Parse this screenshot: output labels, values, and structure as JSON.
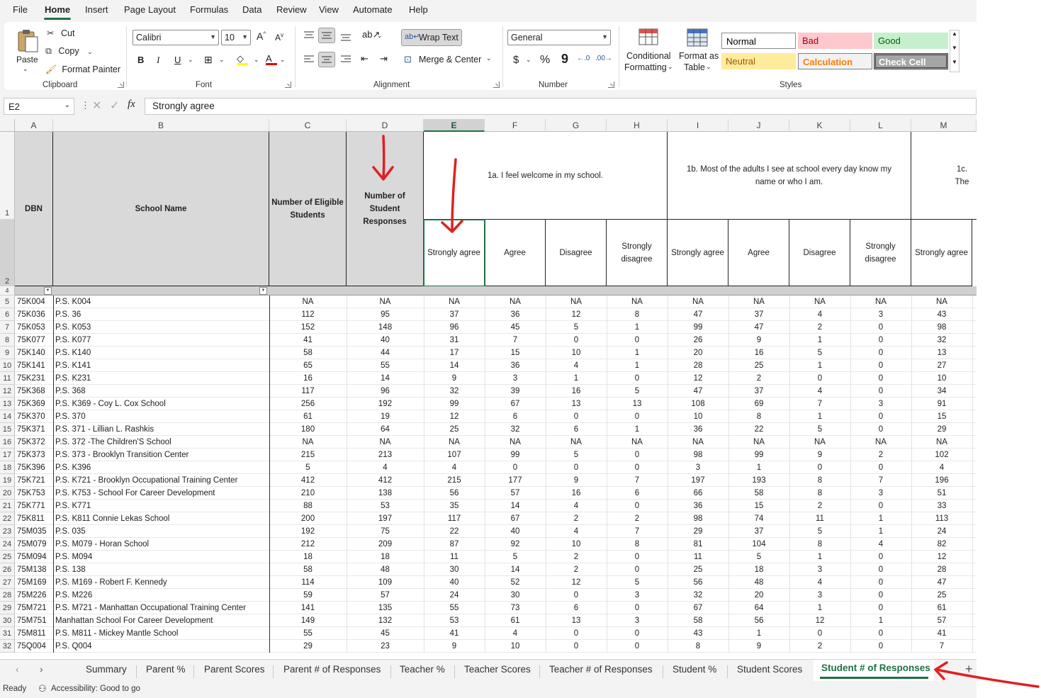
{
  "menu": [
    "File",
    "Home",
    "Insert",
    "Page Layout",
    "Formulas",
    "Data",
    "Review",
    "View",
    "Automate",
    "Help"
  ],
  "ribbon": {
    "paste": "Paste",
    "cut": "Cut",
    "copy": "Copy",
    "format_painter": "Format Painter",
    "clipboard_label": "Clipboard",
    "font_name": "Calibri",
    "font_size": "10",
    "font_label": "Font",
    "bold": "B",
    "italic": "I",
    "underline": "U",
    "wrap_text": "Wrap Text",
    "merge_center": "Merge & Center",
    "alignment_label": "Alignment",
    "number_format": "General",
    "currency": "$",
    "percent": "%",
    "comma": "9",
    "number_label": "Number",
    "cond_format_1": "Conditional",
    "cond_format_2": "Formatting",
    "format_table_1": "Format as",
    "format_table_2": "Table",
    "styles": {
      "normal": "Normal",
      "bad": "Bad",
      "good": "Good",
      "neutral": "Neutral",
      "calculation": "Calculation",
      "check_cell": "Check Cell"
    },
    "styles_label": "Styles"
  },
  "formula_bar": {
    "name_box": "E2",
    "fx": "fx",
    "content": "Strongly agree"
  },
  "columns": [
    "A",
    "B",
    "C",
    "D",
    "E",
    "F",
    "G",
    "H",
    "I",
    "J",
    "K",
    "L",
    "M"
  ],
  "headers": {
    "dbn": "DBN",
    "school_name": "School Name",
    "eligible": "Number of Eligible Students",
    "responses": "Number of Student Responses",
    "q1a": "1a. I feel welcome in my school.",
    "q1b": "1b. Most of the adults I see at school every day know my name or who I am.",
    "q1c": "1c. The",
    "strongly_agree": "Strongly agree",
    "agree": "Agree",
    "disagree": "Disagree",
    "strongly_disagree": "Strongly disagree"
  },
  "row_numbers": [
    "1",
    "2",
    "4",
    "5",
    "6",
    "7",
    "8",
    "9",
    "10",
    "11",
    "12",
    "13",
    "14",
    "15",
    "16",
    "17",
    "18",
    "19",
    "20",
    "21",
    "22",
    "23",
    "24",
    "25",
    "26",
    "27",
    "28",
    "29",
    "30",
    "31",
    "32"
  ],
  "rows": [
    [
      "75K004",
      "P.S. K004",
      "NA",
      "NA",
      "NA",
      "NA",
      "NA",
      "NA",
      "NA",
      "NA",
      "NA",
      "NA",
      "NA"
    ],
    [
      "75K036",
      "P.S. 36",
      "112",
      "95",
      "37",
      "36",
      "12",
      "8",
      "47",
      "37",
      "4",
      "3",
      "43"
    ],
    [
      "75K053",
      "P.S. K053",
      "152",
      "148",
      "96",
      "45",
      "5",
      "1",
      "99",
      "47",
      "2",
      "0",
      "98"
    ],
    [
      "75K077",
      "P.S. K077",
      "41",
      "40",
      "31",
      "7",
      "0",
      "0",
      "26",
      "9",
      "1",
      "0",
      "32"
    ],
    [
      "75K140",
      "P.S. K140",
      "58",
      "44",
      "17",
      "15",
      "10",
      "1",
      "20",
      "16",
      "5",
      "0",
      "13"
    ],
    [
      "75K141",
      "P.S. K141",
      "65",
      "55",
      "14",
      "36",
      "4",
      "1",
      "28",
      "25",
      "1",
      "0",
      "27"
    ],
    [
      "75K231",
      "P.S. K231",
      "16",
      "14",
      "9",
      "3",
      "1",
      "0",
      "12",
      "2",
      "0",
      "0",
      "10"
    ],
    [
      "75K368",
      "P.S. 368",
      "117",
      "96",
      "32",
      "39",
      "16",
      "5",
      "47",
      "37",
      "4",
      "0",
      "34"
    ],
    [
      "75K369",
      "P.S. K369 - Coy L. Cox School",
      "256",
      "192",
      "99",
      "67",
      "13",
      "13",
      "108",
      "69",
      "7",
      "3",
      "91"
    ],
    [
      "75K370",
      "P.S. 370",
      "61",
      "19",
      "12",
      "6",
      "0",
      "0",
      "10",
      "8",
      "1",
      "0",
      "15"
    ],
    [
      "75K371",
      "P.S. 371 - Lillian L. Rashkis",
      "180",
      "64",
      "25",
      "32",
      "6",
      "1",
      "36",
      "22",
      "5",
      "0",
      "29"
    ],
    [
      "75K372",
      "P.S. 372 -The Children'S School",
      "NA",
      "NA",
      "NA",
      "NA",
      "NA",
      "NA",
      "NA",
      "NA",
      "NA",
      "NA",
      "NA"
    ],
    [
      "75K373",
      "P.S. 373 - Brooklyn Transition Center",
      "215",
      "213",
      "107",
      "99",
      "5",
      "0",
      "98",
      "99",
      "9",
      "2",
      "102"
    ],
    [
      "75K396",
      "P.S. K396",
      "5",
      "4",
      "4",
      "0",
      "0",
      "0",
      "3",
      "1",
      "0",
      "0",
      "4"
    ],
    [
      "75K721",
      "P.S. K721 - Brooklyn Occupational Training Center",
      "412",
      "412",
      "215",
      "177",
      "9",
      "7",
      "197",
      "193",
      "8",
      "7",
      "196"
    ],
    [
      "75K753",
      "P.S. K753 - School For Career Development",
      "210",
      "138",
      "56",
      "57",
      "16",
      "6",
      "66",
      "58",
      "8",
      "3",
      "51"
    ],
    [
      "75K771",
      "P.S. K771",
      "88",
      "53",
      "35",
      "14",
      "4",
      "0",
      "36",
      "15",
      "2",
      "0",
      "33"
    ],
    [
      "75K811",
      "P.S. K811 Connie Lekas School",
      "200",
      "197",
      "117",
      "67",
      "2",
      "2",
      "98",
      "74",
      "11",
      "1",
      "113"
    ],
    [
      "75M035",
      "P.S. 035",
      "192",
      "75",
      "22",
      "40",
      "4",
      "7",
      "29",
      "37",
      "5",
      "1",
      "24"
    ],
    [
      "75M079",
      "P.S. M079 - Horan School",
      "212",
      "209",
      "87",
      "92",
      "10",
      "8",
      "81",
      "104",
      "8",
      "4",
      "82"
    ],
    [
      "75M094",
      "P.S. M094",
      "18",
      "18",
      "11",
      "5",
      "2",
      "0",
      "11",
      "5",
      "1",
      "0",
      "12"
    ],
    [
      "75M138",
      "P.S. 138",
      "58",
      "48",
      "30",
      "14",
      "2",
      "0",
      "25",
      "18",
      "3",
      "0",
      "28"
    ],
    [
      "75M169",
      "P.S. M169 - Robert F. Kennedy",
      "114",
      "109",
      "40",
      "52",
      "12",
      "5",
      "56",
      "48",
      "4",
      "0",
      "47"
    ],
    [
      "75M226",
      "P.S. M226",
      "59",
      "57",
      "24",
      "30",
      "0",
      "3",
      "32",
      "20",
      "3",
      "0",
      "25"
    ],
    [
      "75M721",
      "P.S. M721 - Manhattan Occupational Training Center",
      "141",
      "135",
      "55",
      "73",
      "6",
      "0",
      "67",
      "64",
      "1",
      "0",
      "61"
    ],
    [
      "75M751",
      "Manhattan School For Career Development",
      "149",
      "132",
      "53",
      "61",
      "13",
      "3",
      "58",
      "56",
      "12",
      "1",
      "57"
    ],
    [
      "75M811",
      "P.S. M811 - Mickey Mantle School",
      "55",
      "45",
      "41",
      "4",
      "0",
      "0",
      "43",
      "1",
      "0",
      "0",
      "41"
    ],
    [
      "75Q004",
      "P.S. Q004",
      "29",
      "23",
      "9",
      "10",
      "0",
      "0",
      "8",
      "9",
      "2",
      "0",
      "7"
    ]
  ],
  "sheet_tabs": [
    "Summary",
    "Parent %",
    "Parent Scores",
    "Parent # of Responses",
    "Teacher %",
    "Teacher Scores",
    "Teacher # of Responses",
    "Student %",
    "Student Scores",
    "Student # of Responses"
  ],
  "status": {
    "ready": "Ready",
    "accessibility": "Accessibility: Good to go"
  },
  "colors": {
    "accent": "#1e7145",
    "annotation_arrow": "#e02020"
  }
}
